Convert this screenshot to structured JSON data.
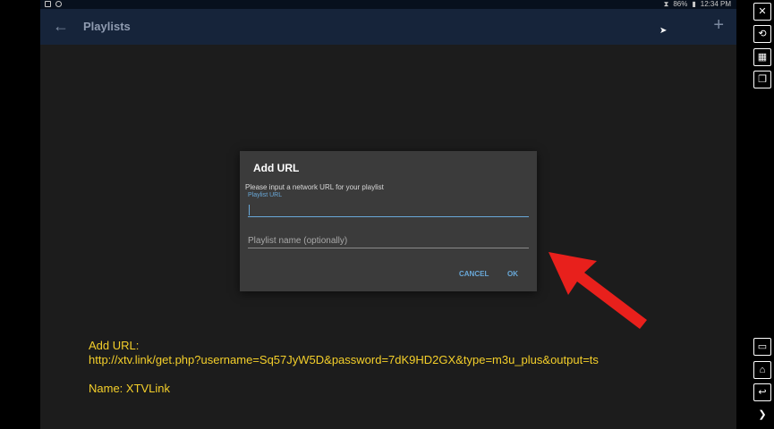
{
  "status_bar": {
    "battery": "86%",
    "time": "12:34 PM"
  },
  "app_bar": {
    "title": "Playlists",
    "back_icon": "arrow-left-icon",
    "add_icon": "plus-icon"
  },
  "dialog": {
    "title": "Add URL",
    "message": "Please input a network URL for your playlist",
    "url_label": "Playlist URL",
    "url_value": "",
    "name_placeholder": "Playlist name (optionally)",
    "cancel_label": "CANCEL",
    "ok_label": "OK"
  },
  "overlay": {
    "add_url_label": "Add URL:",
    "url": "http://xtv.link/get.php?username=Sq57JyW5D&password=7dK9HD2GX&type=m3u_plus&output=ts",
    "name_line": "Name: XTVLink",
    "arrow_color": "#e8201c"
  },
  "right_toolbar": {
    "icons": [
      "fullscreen-exit-icon",
      "rotate-icon",
      "screenshot-icon",
      "window-icon",
      "recent-apps-icon",
      "home-icon",
      "back-icon",
      "chevron-right-icon"
    ]
  },
  "colors": {
    "accent": "#69a8d8",
    "overlay_text": "#f4cf2a",
    "app_bar": "#16243a"
  }
}
